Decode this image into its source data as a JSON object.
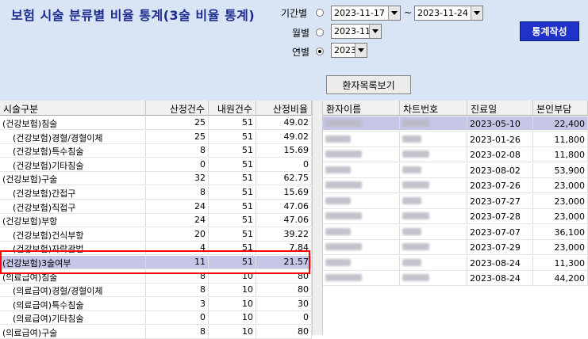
{
  "title": "보험 시술 분류별 비율 통계(3술 비율 통계)",
  "filters": {
    "period_label": "기간별",
    "period_from": "2023-11-17",
    "period_tilde": "~",
    "period_to": "2023-11-24",
    "month_label": "월별",
    "month_value": "2023-11",
    "year_label": "연별",
    "year_value": "2023",
    "selected": "year"
  },
  "buttons": {
    "stats": "통계작성",
    "patient_list": "환자목록보기"
  },
  "left_table": {
    "headers": [
      "시술구분",
      "산정건수",
      "내원건수",
      "산정비율"
    ],
    "rows": [
      {
        "name": "(건강보험)침술",
        "indent": false,
        "count": "25",
        "visits": "51",
        "ratio": "49.02"
      },
      {
        "name": "(건강보험)경혈/경혈이체",
        "indent": true,
        "count": "25",
        "visits": "51",
        "ratio": "49.02"
      },
      {
        "name": "(건강보험)특수침술",
        "indent": true,
        "count": "8",
        "visits": "51",
        "ratio": "15.69"
      },
      {
        "name": "(건강보험)기타침술",
        "indent": true,
        "count": "0",
        "visits": "51",
        "ratio": "0"
      },
      {
        "name": "(건강보험)구술",
        "indent": false,
        "count": "32",
        "visits": "51",
        "ratio": "62.75"
      },
      {
        "name": "(건강보험)간접구",
        "indent": true,
        "count": "8",
        "visits": "51",
        "ratio": "15.69"
      },
      {
        "name": "(건강보험)직접구",
        "indent": true,
        "count": "24",
        "visits": "51",
        "ratio": "47.06"
      },
      {
        "name": "(건강보험)부항",
        "indent": false,
        "count": "24",
        "visits": "51",
        "ratio": "47.06"
      },
      {
        "name": "(건강보험)건식부항",
        "indent": true,
        "count": "20",
        "visits": "51",
        "ratio": "39.22"
      },
      {
        "name": "(건강보험)자락관법",
        "indent": true,
        "count": "4",
        "visits": "51",
        "ratio": "7.84"
      },
      {
        "name": "(건강보험)3술여부",
        "indent": false,
        "count": "11",
        "visits": "51",
        "ratio": "21.57",
        "selected": true
      },
      {
        "name": "(의료급여)침술",
        "indent": false,
        "count": "8",
        "visits": "10",
        "ratio": "80"
      },
      {
        "name": "(의료급여)경혈/경혈이체",
        "indent": true,
        "count": "8",
        "visits": "10",
        "ratio": "80"
      },
      {
        "name": "(의료급여)특수침술",
        "indent": true,
        "count": "3",
        "visits": "10",
        "ratio": "30"
      },
      {
        "name": "(의료급여)기타침술",
        "indent": true,
        "count": "0",
        "visits": "10",
        "ratio": "0"
      },
      {
        "name": "(의료급여)구술",
        "indent": false,
        "count": "8",
        "visits": "10",
        "ratio": "80"
      }
    ]
  },
  "right_table": {
    "headers": [
      "환자이름",
      "차트번호",
      "진료일",
      "본인부담"
    ],
    "rows": [
      {
        "date": "2023-05-10",
        "amount": "22,400",
        "selected": true
      },
      {
        "date": "2023-01-26",
        "amount": "11,800"
      },
      {
        "date": "2023-02-08",
        "amount": "11,800"
      },
      {
        "date": "2023-08-02",
        "amount": "53,900"
      },
      {
        "date": "2023-07-26",
        "amount": "23,000"
      },
      {
        "date": "2023-07-27",
        "amount": "23,000"
      },
      {
        "date": "2023-07-28",
        "amount": "23,000"
      },
      {
        "date": "2023-07-07",
        "amount": "36,100"
      },
      {
        "date": "2023-07-29",
        "amount": "23,000"
      },
      {
        "date": "2023-08-24",
        "amount": "11,300"
      },
      {
        "date": "2023-08-24",
        "amount": "44,200"
      }
    ]
  },
  "colors": {
    "top_bg": "#d9e4f5",
    "selected_row": "#c5c5e8",
    "title": "#1d2c8c",
    "stats_button": "#1f33c8",
    "highlight_box": "#ff0000"
  }
}
